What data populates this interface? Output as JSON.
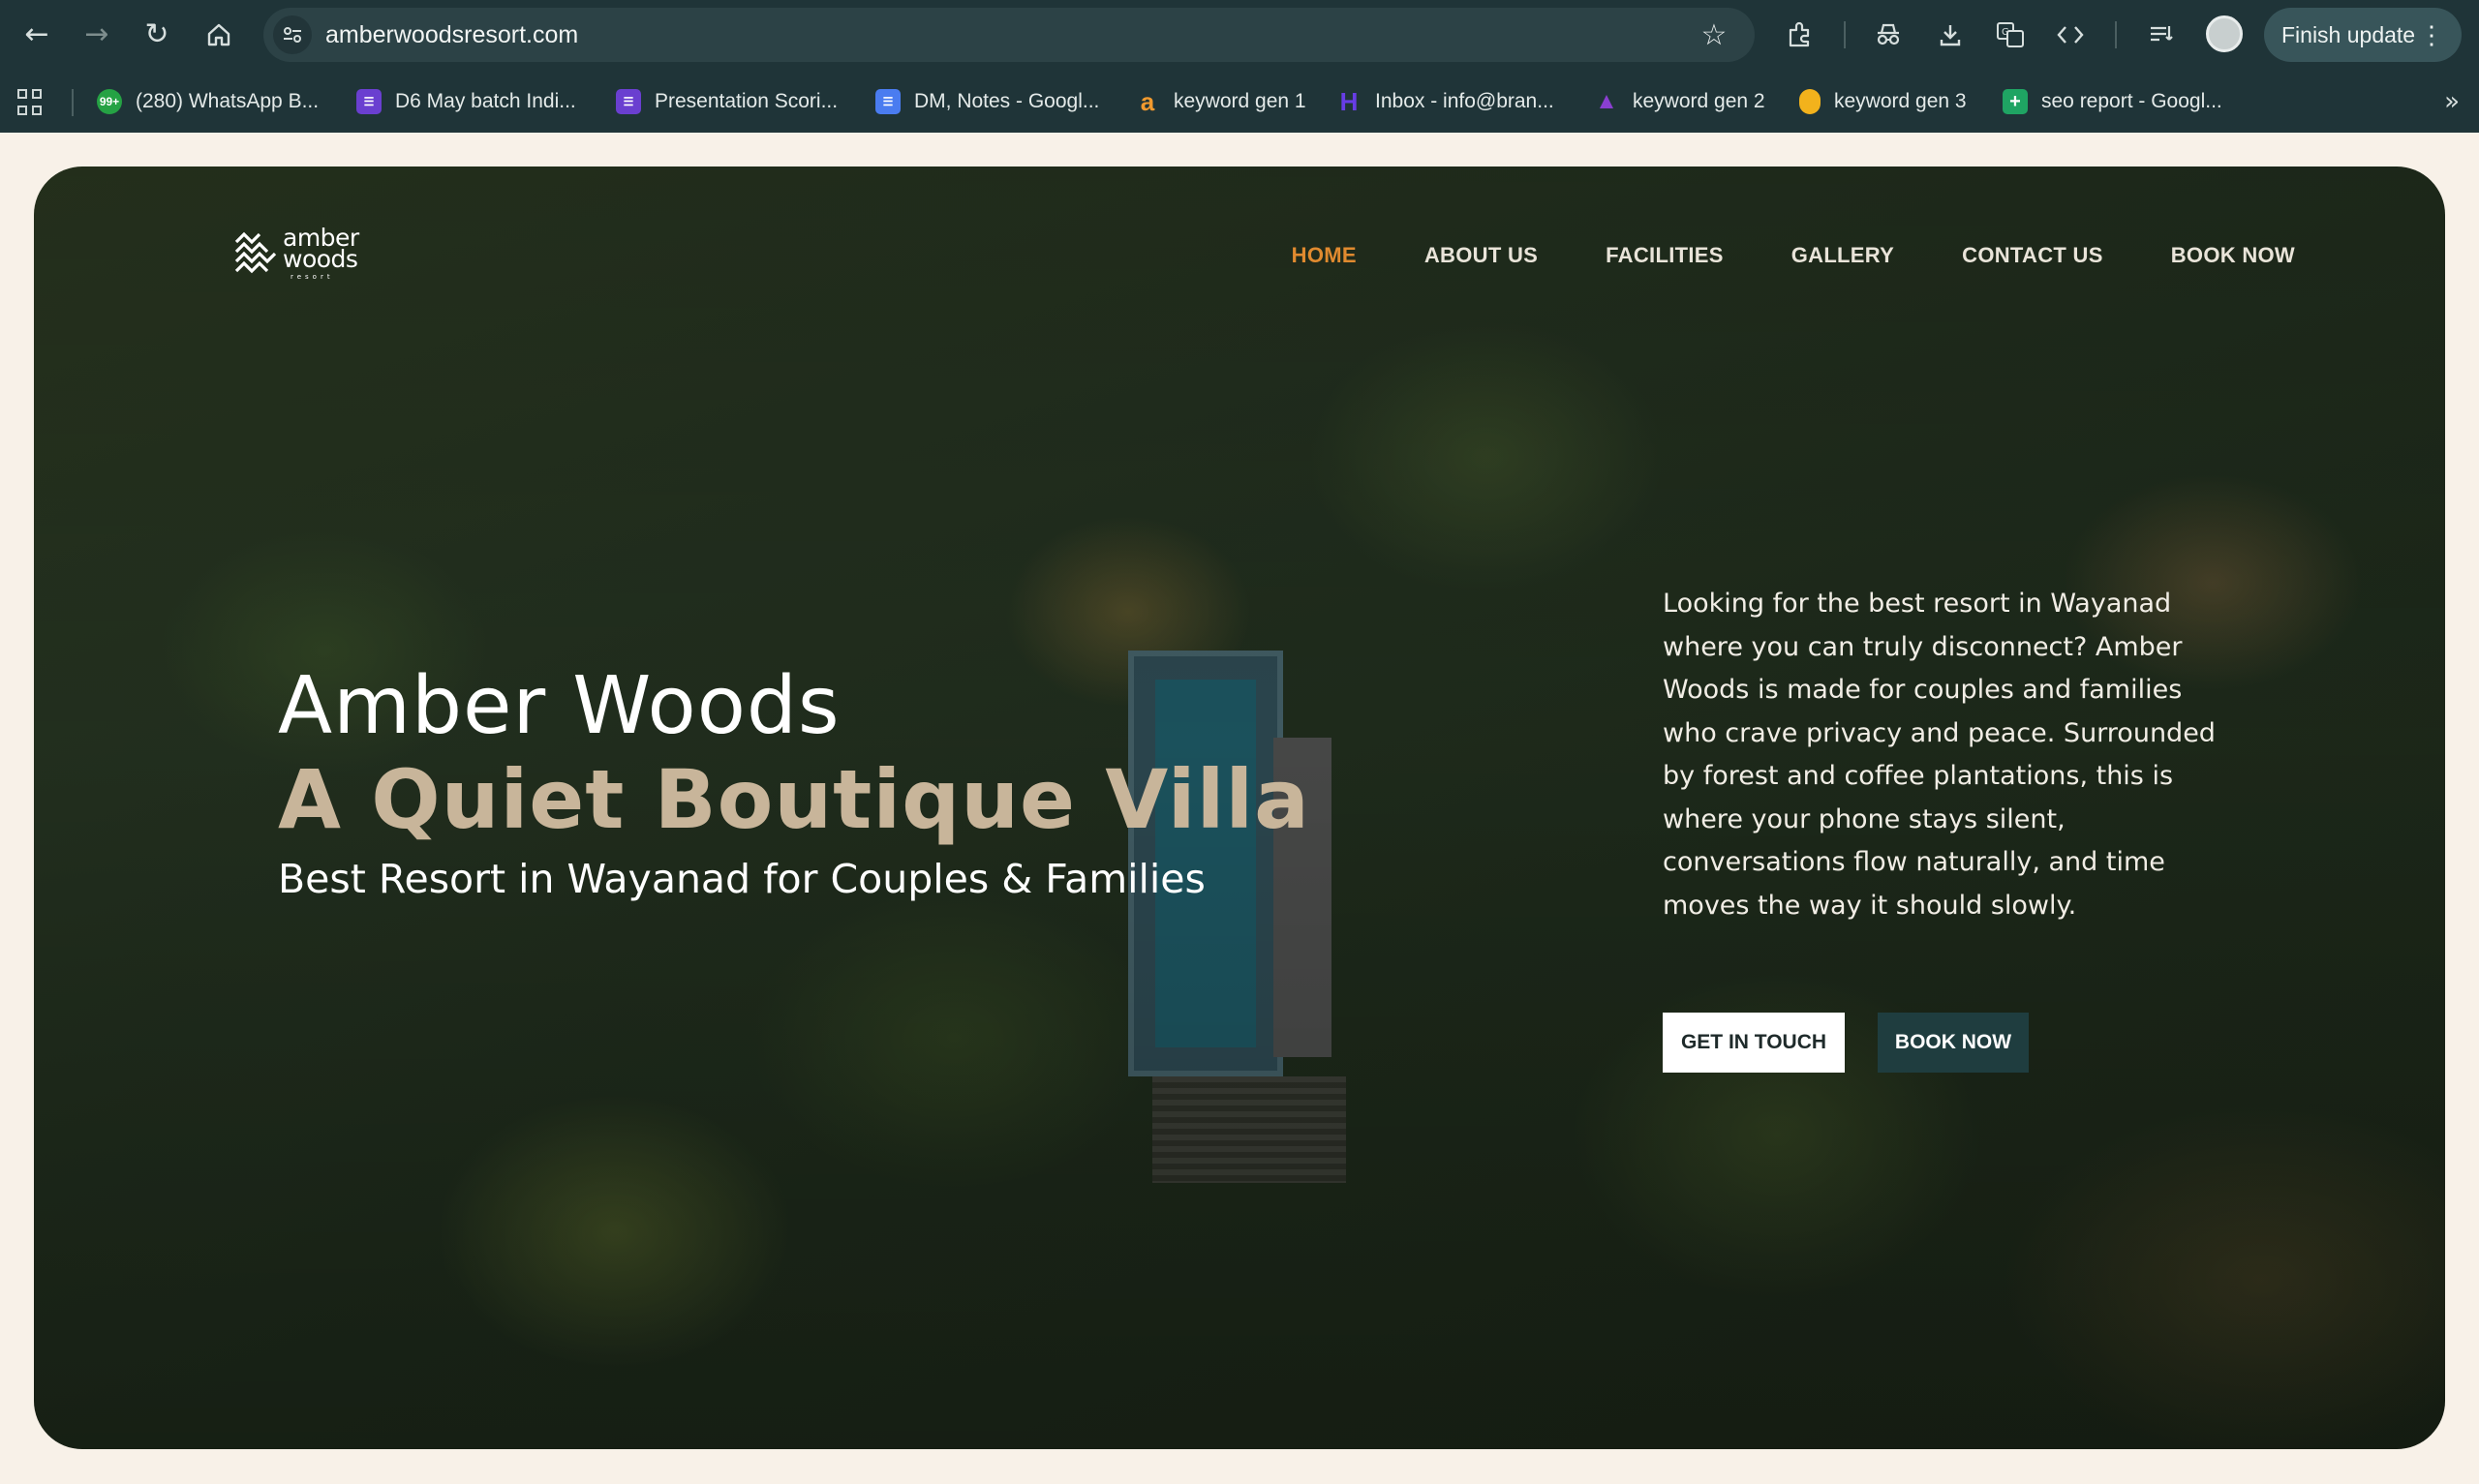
{
  "browser": {
    "url": "amberwoodsresort.com",
    "finish_update_label": "Finish update",
    "bookmarks": [
      {
        "label": "(280) WhatsApp B...",
        "icon": "whatsapp-icon",
        "badge": "99+",
        "color": "#25a244"
      },
      {
        "label": "D6 May batch Indi...",
        "icon": "forms-icon",
        "color": "#6a3fd0"
      },
      {
        "label": "Presentation Scori...",
        "icon": "forms-icon",
        "color": "#6a3fd0"
      },
      {
        "label": "DM, Notes - Googl...",
        "icon": "docs-icon",
        "color": "#4a7cf0"
      },
      {
        "label": "keyword gen 1",
        "icon": "amazon-a-icon",
        "color": "#f29a2e"
      },
      {
        "label": "Inbox - info@bran...",
        "icon": "hostinger-icon",
        "color": "#673de6"
      },
      {
        "label": "keyword gen 2",
        "icon": "wizard-hat-icon",
        "color": "#8a3fd0"
      },
      {
        "label": "keyword gen 3",
        "icon": "egg-icon",
        "color": "#f2b21c"
      },
      {
        "label": "seo report - Googl...",
        "icon": "sheets-icon",
        "color": "#1fa463"
      }
    ]
  },
  "site": {
    "logo": {
      "line1": "amber",
      "line2": "woods",
      "line3": "resort"
    },
    "nav": [
      {
        "label": "HOME",
        "active": true
      },
      {
        "label": "ABOUT US",
        "active": false
      },
      {
        "label": "FACILITIES",
        "active": false
      },
      {
        "label": "GALLERY",
        "active": false
      },
      {
        "label": "CONTACT US",
        "active": false
      },
      {
        "label": "BOOK NOW",
        "active": false
      }
    ],
    "hero": {
      "title": "Amber Woods",
      "subtitle": "A Quiet Boutique Villa",
      "tagline": "Best Resort in Wayanad for Couples & Families",
      "intro": "Looking for the best resort in Wayanad where you can truly disconnect? Amber Woods is made for couples and families who crave privacy and peace. Surrounded by forest and coffee plantations, this is where your phone stays silent, conversations flow naturally, and time moves the way it should slowly.",
      "get_in_touch_label": "GET IN TOUCH",
      "book_now_label": "BOOK NOW"
    }
  },
  "colors": {
    "nav_active": "#e08a2f",
    "subtitle": "#c8b59a",
    "book_button": "#1f3d3f",
    "page_bg": "#f8f1e8",
    "chrome_bg": "#1f3438"
  }
}
